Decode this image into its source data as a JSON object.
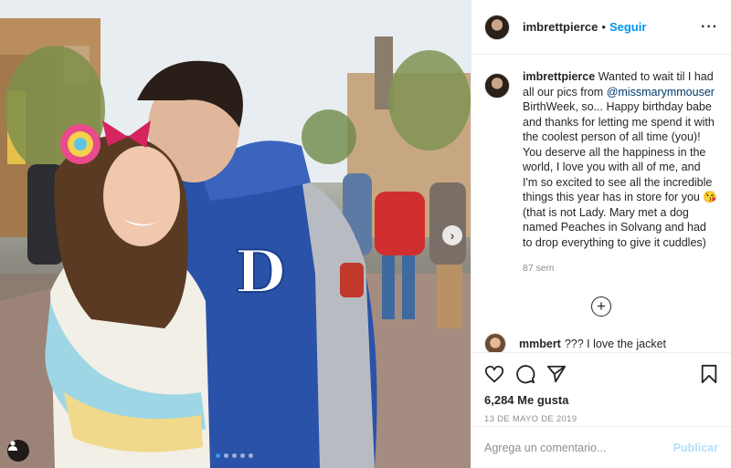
{
  "post": {
    "username": "imbrettpierce",
    "follow_label": "Seguir",
    "more_icon": "ellipsis-icon",
    "photo_dots_count": 5,
    "photo_active_dot": 1
  },
  "caption": {
    "username": "imbrettpierce",
    "text_before_mention": "Wanted to wait til I had all our pics from ",
    "mention": "@missmarymmouser",
    "text_after_mention": " BirthWeek, so... Happy birthday babe and thanks for letting me spend it with the coolest person of all time (you)! You deserve all the happiness in the world, I love you with all of me, and I'm so excited to see all the incredible things this year has in store for you 😘 (that is not Lady. Mary met a dog named Peaches in Solvang and had to drop everything to give it cuddles)",
    "time_ago": "87 sem"
  },
  "next_comment": {
    "username": "mmbert",
    "text": "??? I love the jacket"
  },
  "actions": {
    "likes": "6,284 Me gusta",
    "date": "13 DE MAYO DE 2019"
  },
  "comment_box": {
    "placeholder": "Agrega un comentario...",
    "publish_label": "Publicar"
  },
  "colors": {
    "accent": "#0095f6",
    "publish_disabled": "#b2dffc",
    "active_dot": "#3897f0"
  }
}
